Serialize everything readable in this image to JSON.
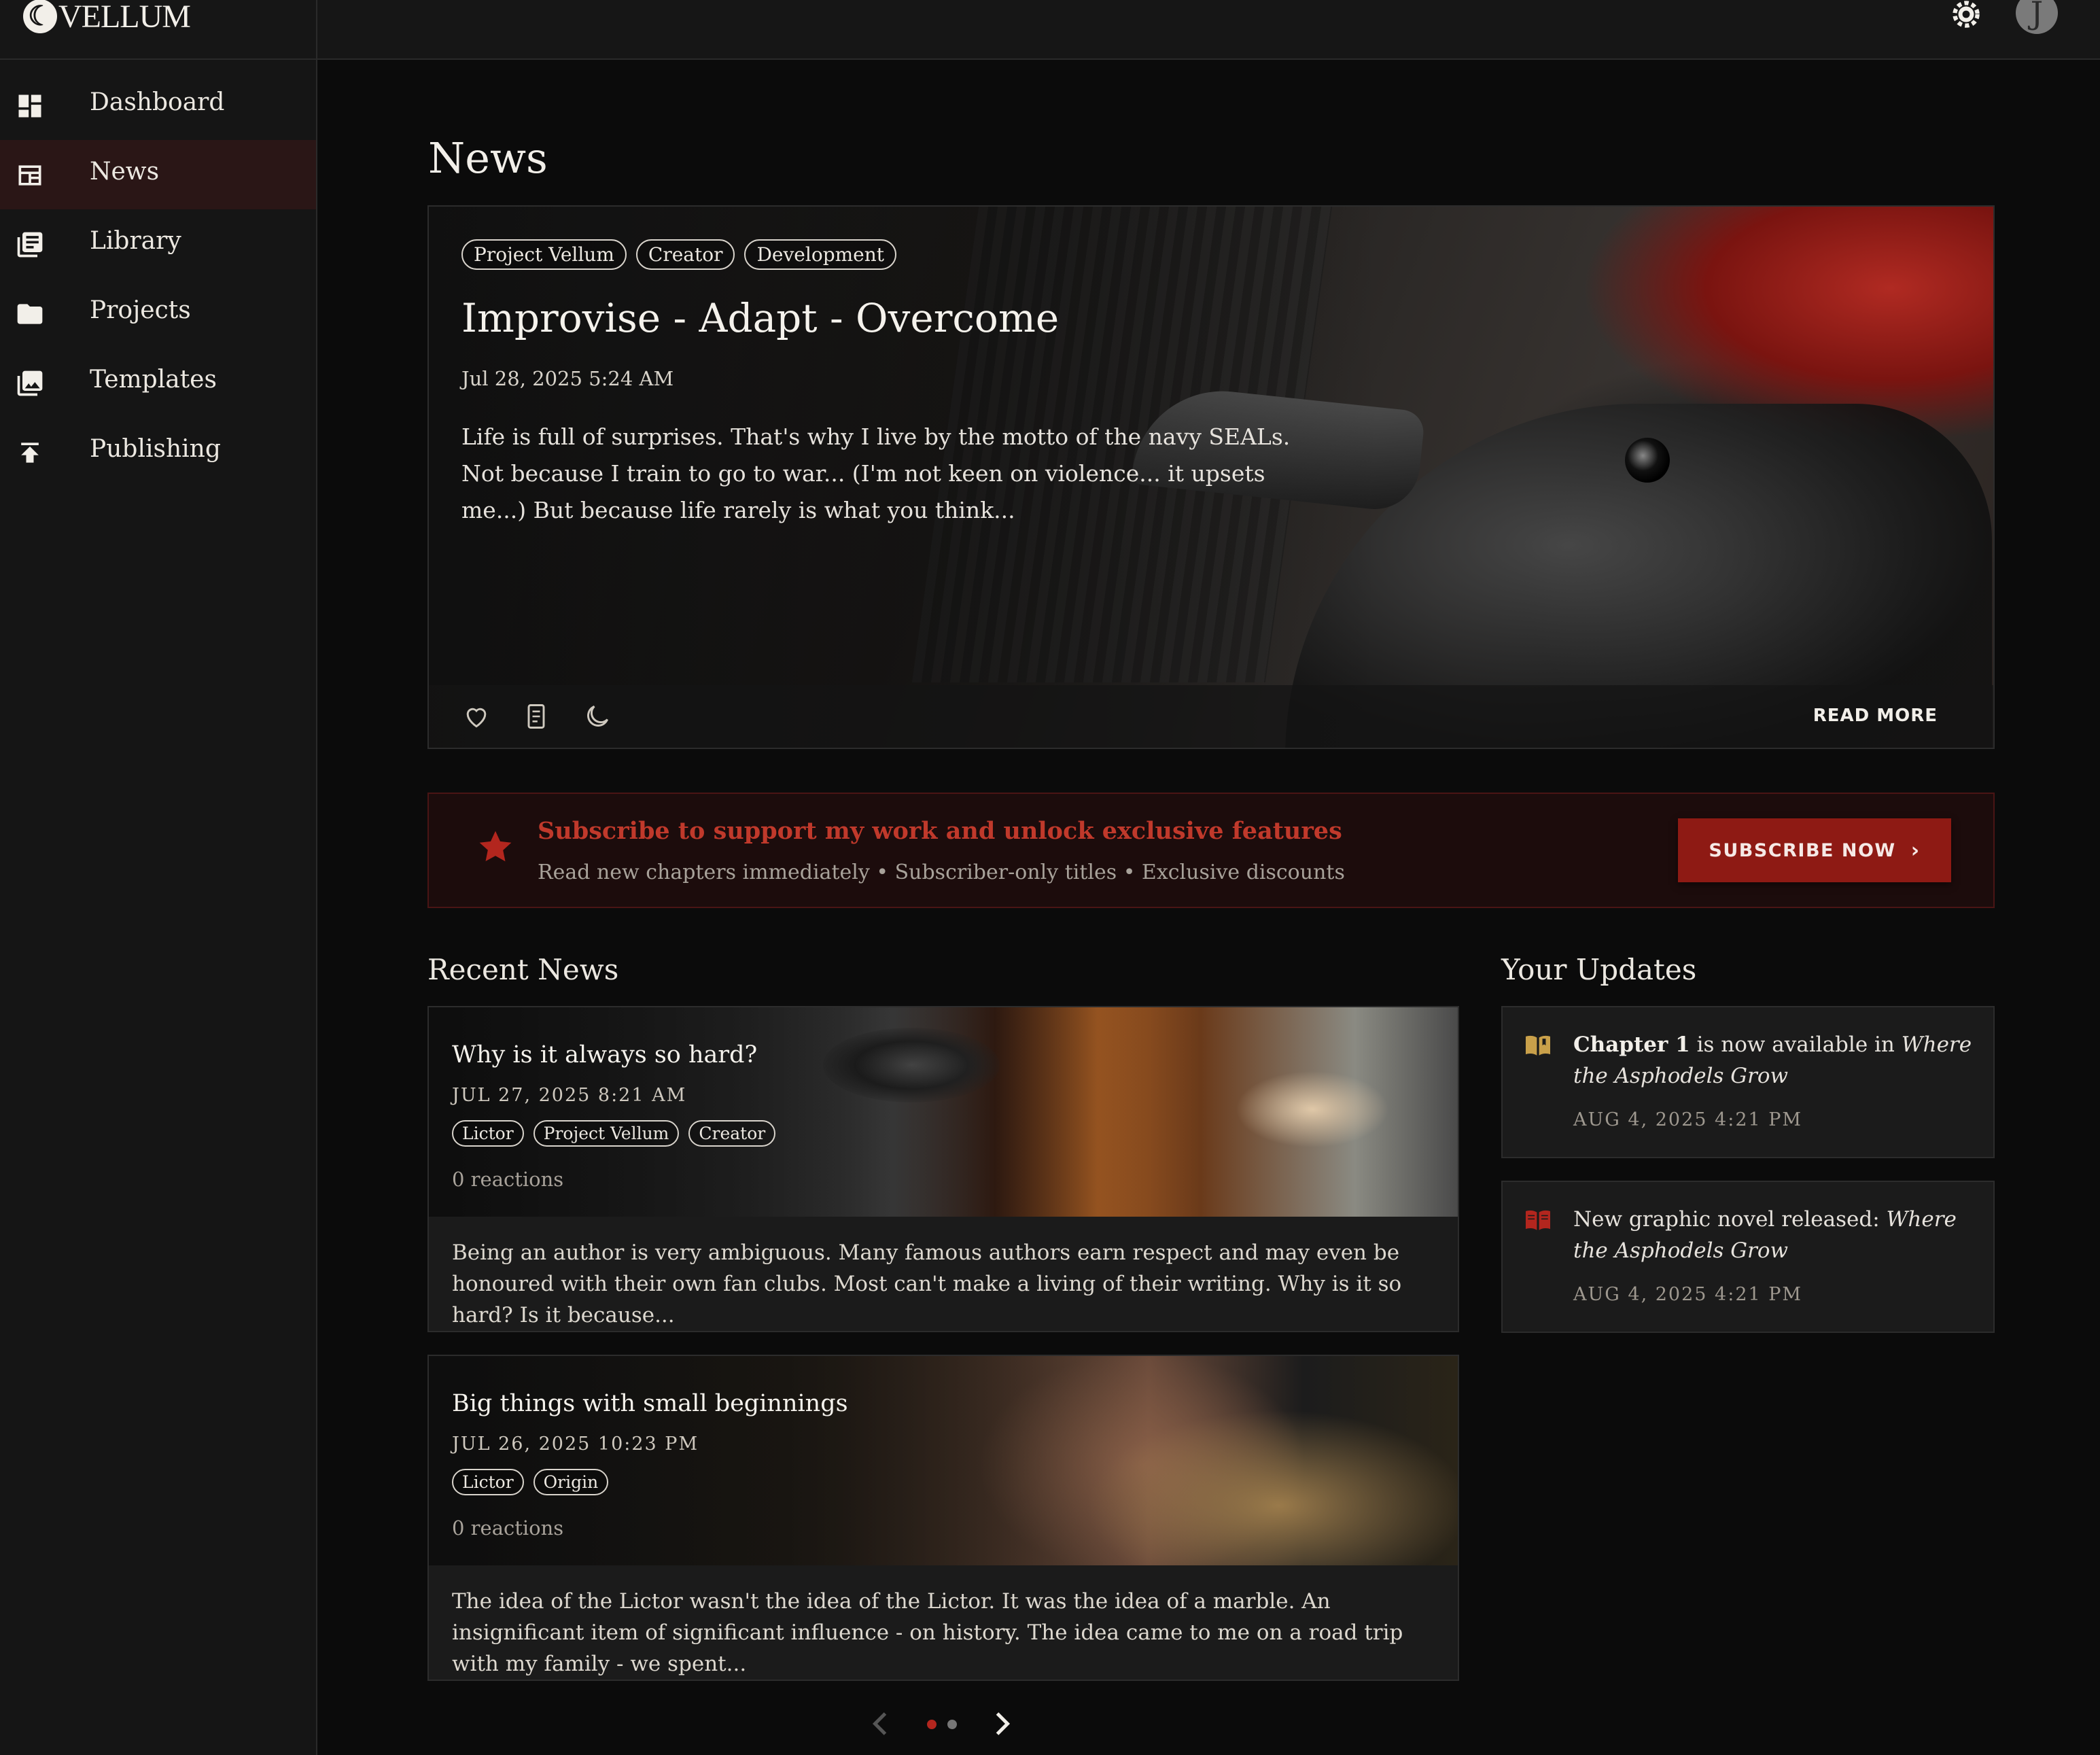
{
  "app": {
    "logo_text": "VELLUM",
    "avatar_initial": "J"
  },
  "sidebar": {
    "items": [
      {
        "label": "Dashboard",
        "icon": "dashboard-icon"
      },
      {
        "label": "News",
        "icon": "news-icon",
        "active": true
      },
      {
        "label": "Library",
        "icon": "library-icon"
      },
      {
        "label": "Projects",
        "icon": "folder-icon"
      },
      {
        "label": "Templates",
        "icon": "image-icon"
      },
      {
        "label": "Publishing",
        "icon": "publish-icon"
      }
    ]
  },
  "page": {
    "title": "News"
  },
  "featured": {
    "tags": [
      "Project Vellum",
      "Creator",
      "Development"
    ],
    "title": "Improvise - Adapt - Overcome",
    "date": "Jul 28, 2025 5:24 AM",
    "excerpt": "Life is full of surprises. That's why I live by the motto of the navy SEALs. Not because I train to go to war... (I'm not keen on violence... it upsets me...) But because life rarely is what you think...",
    "read_more": "READ MORE",
    "actions": [
      "heart-icon",
      "bookmark-icon",
      "moon-icon"
    ]
  },
  "subscribe": {
    "title": "Subscribe to support my work and unlock exclusive features",
    "description": "Read new chapters immediately • Subscriber-only titles • Exclusive discounts",
    "button": "SUBSCRIBE NOW",
    "accent": "#8e1a14"
  },
  "recent": {
    "heading": "Recent News",
    "cards": [
      {
        "title": "Why is it always so hard?",
        "date": "JUL 27, 2025 8:21 AM",
        "tags": [
          "Lictor",
          "Project Vellum",
          "Creator"
        ],
        "reactions": "0 reactions",
        "body": "Being an author is very ambiguous. Many famous authors earn respect and may even be honoured with their own fan clubs. Most can't make a living of their writing. Why is it so hard? Is it because..."
      },
      {
        "title": "Big things with small beginnings",
        "date": "JUL 26, 2025 10:23 PM",
        "tags": [
          "Lictor",
          "Origin"
        ],
        "reactions": "0 reactions",
        "body": "The idea of the Lictor wasn't the idea of the Lictor. It was the idea of a marble. An insignificant item of significant influence - on history. The idea came to me on a road trip with my family - we spent..."
      }
    ]
  },
  "updates": {
    "heading": "Your Updates",
    "items": [
      {
        "icon": "open-book-icon",
        "bold": "Chapter 1",
        "text": " is now available in ",
        "italic": "Where the Asphodels Grow",
        "date": "AUG 4, 2025 4:21 PM"
      },
      {
        "icon": "book-icon",
        "bold": "",
        "text": "New graphic novel released: ",
        "italic": "Where the Asphodels Grow",
        "date": "AUG 4, 2025 4:21 PM"
      }
    ]
  },
  "pagination": {
    "current": 1,
    "total": 2
  }
}
